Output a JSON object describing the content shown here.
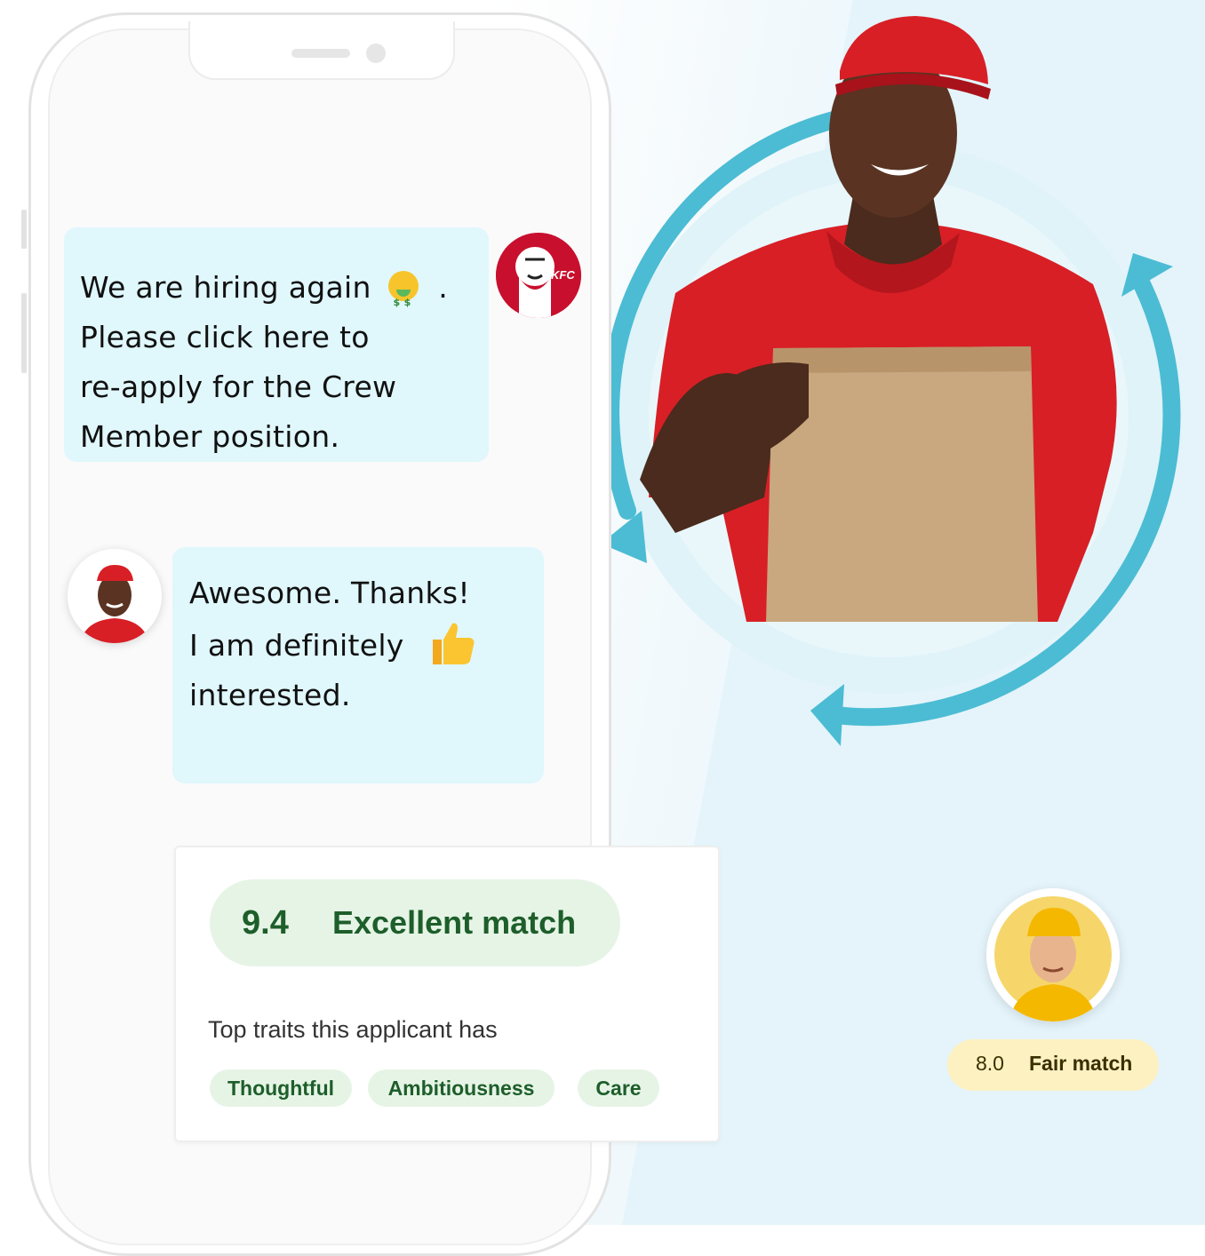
{
  "chat": {
    "employer_message_lines": [
      "We are hiring again",
      "Please click here to",
      "re-apply for the Crew",
      "Member position."
    ],
    "employer_message_suffix": ".",
    "applicant_message_lines": [
      "Awesome. Thanks!",
      "I am definitely",
      "interested."
    ]
  },
  "avatars": {
    "employer_logo_text": "KFC"
  },
  "match_card": {
    "score": "9.4",
    "label": "Excellent match",
    "traits_title": "Top traits this applicant has",
    "traits": [
      "Thoughtful",
      "Ambitiousness",
      "Care"
    ]
  },
  "secondary_candidate": {
    "score": "8.0",
    "label": "Fair match"
  },
  "colors": {
    "bubble_bg": "#e0f7fc",
    "cycle_arrow": "#4bbcd3",
    "match_green": "#1d5e2a",
    "match_pill_bg": "#e6f4e6",
    "fair_pill_bg": "#fdf1c2",
    "shirt_red": "#d81f26"
  },
  "icons": {
    "money_face": "money-mouth-face-emoji",
    "thumbs_up": "thumbs-up-emoji",
    "cycle": "refresh-cycle-arrows"
  }
}
